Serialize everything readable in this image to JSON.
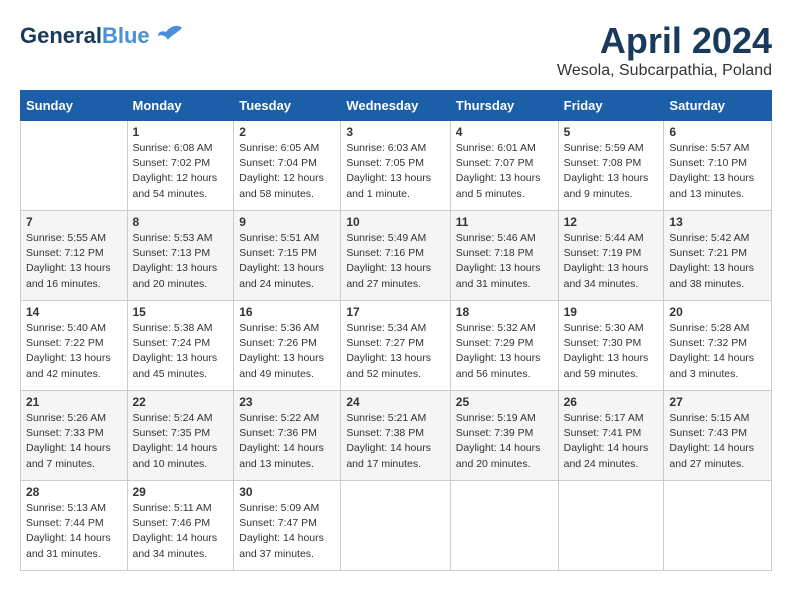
{
  "header": {
    "logo_line1": "General",
    "logo_line2": "Blue",
    "month": "April 2024",
    "location": "Wesola, Subcarpathia, Poland"
  },
  "weekdays": [
    "Sunday",
    "Monday",
    "Tuesday",
    "Wednesday",
    "Thursday",
    "Friday",
    "Saturday"
  ],
  "weeks": [
    [
      {
        "day": "",
        "info": ""
      },
      {
        "day": "1",
        "info": "Sunrise: 6:08 AM\nSunset: 7:02 PM\nDaylight: 12 hours\nand 54 minutes."
      },
      {
        "day": "2",
        "info": "Sunrise: 6:05 AM\nSunset: 7:04 PM\nDaylight: 12 hours\nand 58 minutes."
      },
      {
        "day": "3",
        "info": "Sunrise: 6:03 AM\nSunset: 7:05 PM\nDaylight: 13 hours\nand 1 minute."
      },
      {
        "day": "4",
        "info": "Sunrise: 6:01 AM\nSunset: 7:07 PM\nDaylight: 13 hours\nand 5 minutes."
      },
      {
        "day": "5",
        "info": "Sunrise: 5:59 AM\nSunset: 7:08 PM\nDaylight: 13 hours\nand 9 minutes."
      },
      {
        "day": "6",
        "info": "Sunrise: 5:57 AM\nSunset: 7:10 PM\nDaylight: 13 hours\nand 13 minutes."
      }
    ],
    [
      {
        "day": "7",
        "info": "Sunrise: 5:55 AM\nSunset: 7:12 PM\nDaylight: 13 hours\nand 16 minutes."
      },
      {
        "day": "8",
        "info": "Sunrise: 5:53 AM\nSunset: 7:13 PM\nDaylight: 13 hours\nand 20 minutes."
      },
      {
        "day": "9",
        "info": "Sunrise: 5:51 AM\nSunset: 7:15 PM\nDaylight: 13 hours\nand 24 minutes."
      },
      {
        "day": "10",
        "info": "Sunrise: 5:49 AM\nSunset: 7:16 PM\nDaylight: 13 hours\nand 27 minutes."
      },
      {
        "day": "11",
        "info": "Sunrise: 5:46 AM\nSunset: 7:18 PM\nDaylight: 13 hours\nand 31 minutes."
      },
      {
        "day": "12",
        "info": "Sunrise: 5:44 AM\nSunset: 7:19 PM\nDaylight: 13 hours\nand 34 minutes."
      },
      {
        "day": "13",
        "info": "Sunrise: 5:42 AM\nSunset: 7:21 PM\nDaylight: 13 hours\nand 38 minutes."
      }
    ],
    [
      {
        "day": "14",
        "info": "Sunrise: 5:40 AM\nSunset: 7:22 PM\nDaylight: 13 hours\nand 42 minutes."
      },
      {
        "day": "15",
        "info": "Sunrise: 5:38 AM\nSunset: 7:24 PM\nDaylight: 13 hours\nand 45 minutes."
      },
      {
        "day": "16",
        "info": "Sunrise: 5:36 AM\nSunset: 7:26 PM\nDaylight: 13 hours\nand 49 minutes."
      },
      {
        "day": "17",
        "info": "Sunrise: 5:34 AM\nSunset: 7:27 PM\nDaylight: 13 hours\nand 52 minutes."
      },
      {
        "day": "18",
        "info": "Sunrise: 5:32 AM\nSunset: 7:29 PM\nDaylight: 13 hours\nand 56 minutes."
      },
      {
        "day": "19",
        "info": "Sunrise: 5:30 AM\nSunset: 7:30 PM\nDaylight: 13 hours\nand 59 minutes."
      },
      {
        "day": "20",
        "info": "Sunrise: 5:28 AM\nSunset: 7:32 PM\nDaylight: 14 hours\nand 3 minutes."
      }
    ],
    [
      {
        "day": "21",
        "info": "Sunrise: 5:26 AM\nSunset: 7:33 PM\nDaylight: 14 hours\nand 7 minutes."
      },
      {
        "day": "22",
        "info": "Sunrise: 5:24 AM\nSunset: 7:35 PM\nDaylight: 14 hours\nand 10 minutes."
      },
      {
        "day": "23",
        "info": "Sunrise: 5:22 AM\nSunset: 7:36 PM\nDaylight: 14 hours\nand 13 minutes."
      },
      {
        "day": "24",
        "info": "Sunrise: 5:21 AM\nSunset: 7:38 PM\nDaylight: 14 hours\nand 17 minutes."
      },
      {
        "day": "25",
        "info": "Sunrise: 5:19 AM\nSunset: 7:39 PM\nDaylight: 14 hours\nand 20 minutes."
      },
      {
        "day": "26",
        "info": "Sunrise: 5:17 AM\nSunset: 7:41 PM\nDaylight: 14 hours\nand 24 minutes."
      },
      {
        "day": "27",
        "info": "Sunrise: 5:15 AM\nSunset: 7:43 PM\nDaylight: 14 hours\nand 27 minutes."
      }
    ],
    [
      {
        "day": "28",
        "info": "Sunrise: 5:13 AM\nSunset: 7:44 PM\nDaylight: 14 hours\nand 31 minutes."
      },
      {
        "day": "29",
        "info": "Sunrise: 5:11 AM\nSunset: 7:46 PM\nDaylight: 14 hours\nand 34 minutes."
      },
      {
        "day": "30",
        "info": "Sunrise: 5:09 AM\nSunset: 7:47 PM\nDaylight: 14 hours\nand 37 minutes."
      },
      {
        "day": "",
        "info": ""
      },
      {
        "day": "",
        "info": ""
      },
      {
        "day": "",
        "info": ""
      },
      {
        "day": "",
        "info": ""
      }
    ]
  ]
}
